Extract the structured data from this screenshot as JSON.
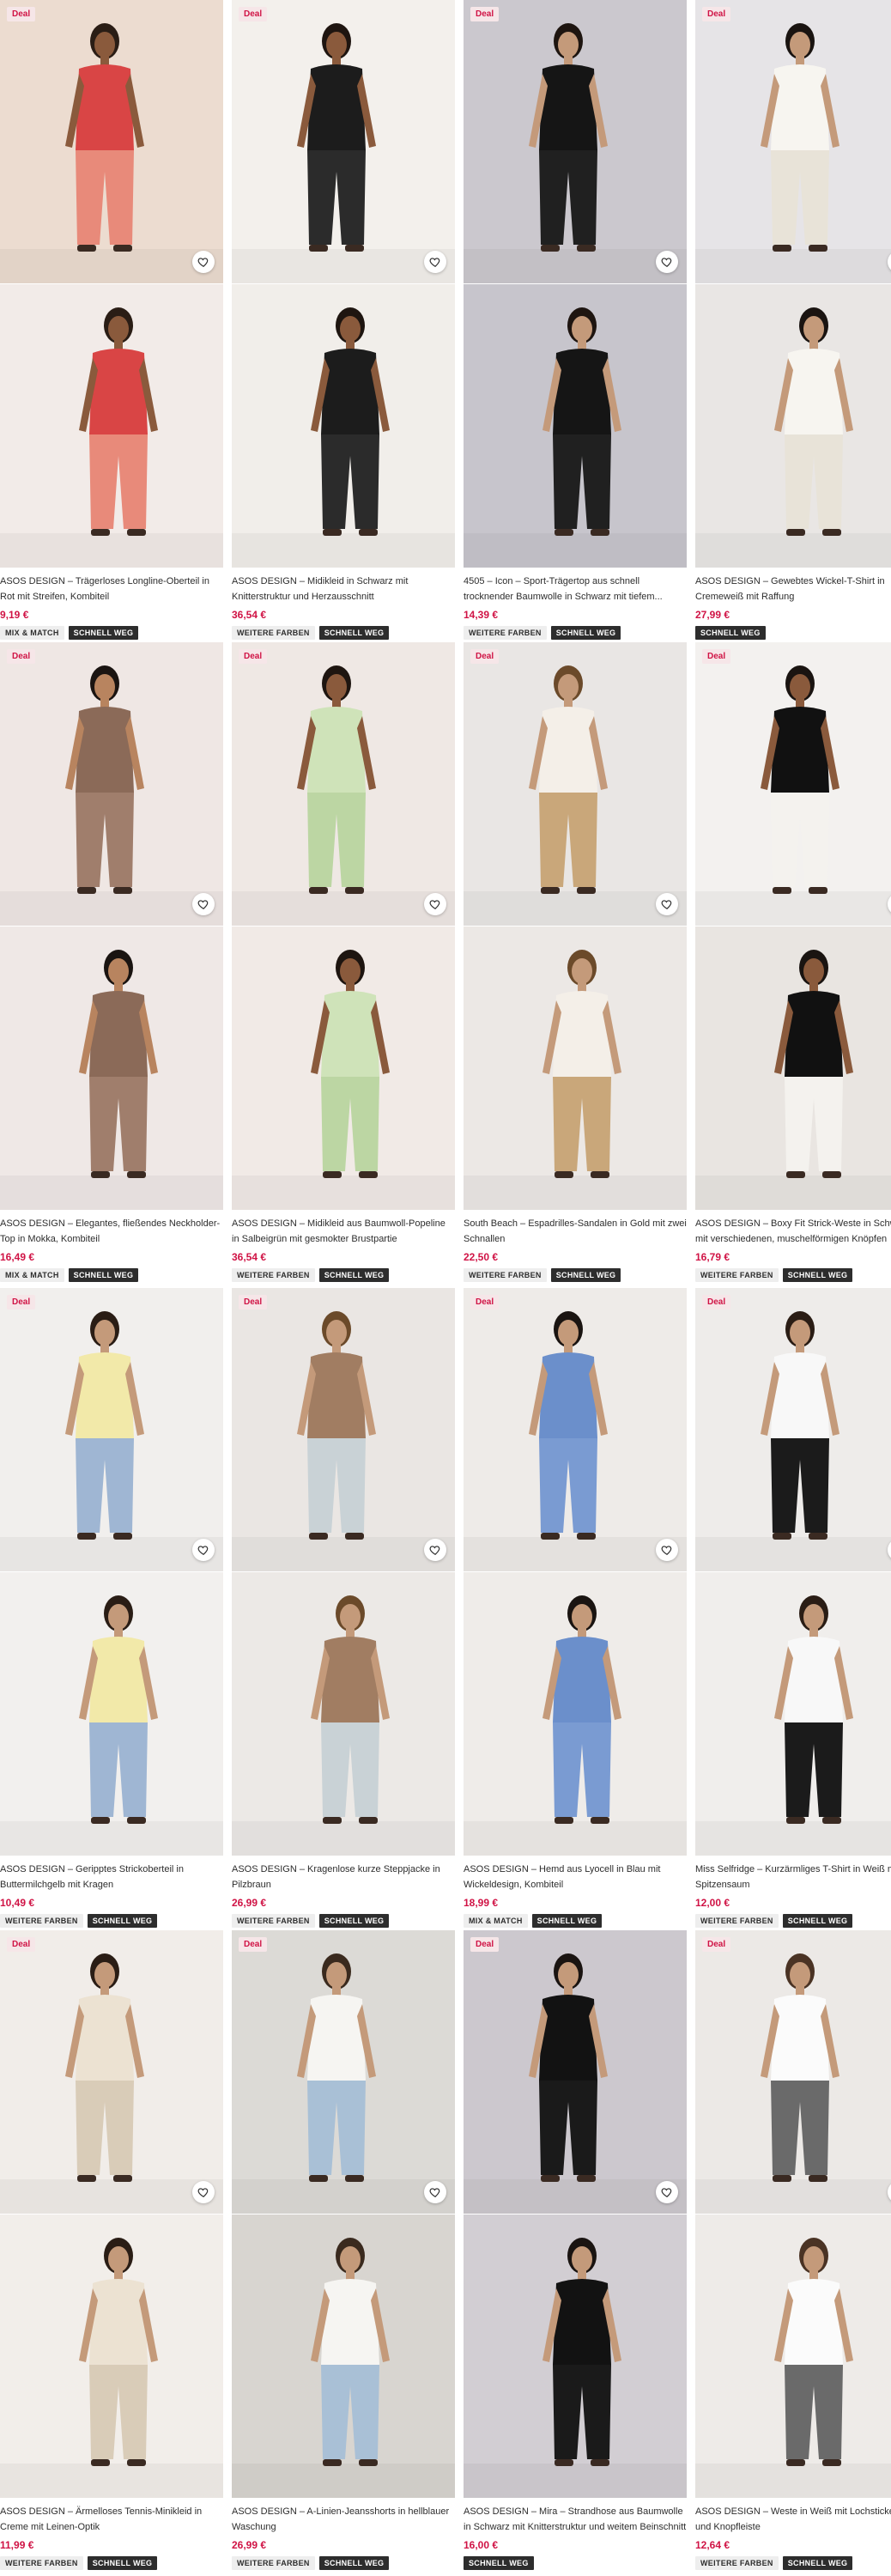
{
  "deal_label": "Deal",
  "products": [
    {
      "title": "ASOS DESIGN – Trägerloses Longline-Oberteil in Rot mit Streifen, Kombiteil",
      "price": "9,19 €",
      "badges": [
        "MIX & MATCH",
        "SCHNELL WEG"
      ],
      "bg_top": "#ecdcd0",
      "bg_bottom": "#f2ebe8",
      "garment": "#d94545",
      "garment2": "#e88a7a",
      "skin": "#8a5a3c",
      "hair": "#2a1d15"
    },
    {
      "title": "ASOS DESIGN – Midikleid in Schwarz mit Knitterstruktur und Herzausschnitt",
      "price": "36,54 €",
      "badges": [
        "WEITERE FARBEN",
        "SCHNELL WEG"
      ],
      "bg_top": "#f3f0ec",
      "bg_bottom": "#f1eeea",
      "garment": "#1c1c1c",
      "garment2": "#2b2b2b",
      "skin": "#8a5a3c",
      "hair": "#1e1510"
    },
    {
      "title": "4505 – Icon – Sport-Trägertop aus schnell trocknender Baumwolle in Schwarz mit tiefem...",
      "price": "14,39 €",
      "badges": [
        "WEITERE FARBEN",
        "SCHNELL WEG"
      ],
      "bg_top": "#cbc8ce",
      "bg_bottom": "#c7c5cc",
      "garment": "#151515",
      "garment2": "#202020",
      "skin": "#c49a7a",
      "hair": "#1e1510"
    },
    {
      "title": "ASOS DESIGN – Gewebtes Wickel-T-Shirt in Cremeweiß mit Raffung",
      "price": "27,99 €",
      "badges": [
        "SCHNELL WEG"
      ],
      "bg_top": "#e6e4e7",
      "bg_bottom": "#e9e6e4",
      "garment": "#f7f5f0",
      "garment2": "#e8e3d8",
      "skin": "#c49a7a",
      "hair": "#1a1411"
    },
    {
      "title": "ASOS DESIGN – Elegantes, fließendes Neckholder-Top in Mokka, Kombiteil",
      "price": "16,49 €",
      "badges": [
        "MIX & MATCH",
        "SCHNELL WEG"
      ],
      "bg_top": "#efe7e4",
      "bg_bottom": "#efe8e6",
      "garment": "#8b6a58",
      "garment2": "#a07e6c",
      "skin": "#b8845f",
      "hair": "#1a1411"
    },
    {
      "title": "ASOS DESIGN – Midikleid aus Baumwoll-Popeline in Salbeigrün mit gesmokter Brustpartie",
      "price": "36,54 €",
      "badges": [
        "WEITERE FARBEN",
        "SCHNELL WEG"
      ],
      "bg_top": "#efe8e4",
      "bg_bottom": "#f1eae6",
      "garment": "#cfe3b9",
      "garment2": "#bcd6a3",
      "skin": "#8a5a3c",
      "hair": "#1e1510"
    },
    {
      "title": "South Beach – Espadrilles-Sandalen in Gold mit zwei Schnallen",
      "price": "22,50 €",
      "badges": [
        "WEITERE FARBEN",
        "SCHNELL WEG"
      ],
      "bg_top": "#e9e6e4",
      "bg_bottom": "#ece8e5",
      "garment": "#f4efe8",
      "garment2": "#c9a77a",
      "skin": "#c49a7a",
      "hair": "#6b4a2a"
    },
    {
      "title": "ASOS DESIGN – Boxy Fit Strick-Weste in Schwarz mit verschiedenen, muschelförmigen Knöpfen",
      "price": "16,79 €",
      "badges": [
        "WEITERE FARBEN",
        "SCHNELL WEG"
      ],
      "bg_top": "#f3f1ef",
      "bg_bottom": "#e9e5e1",
      "garment": "#111111",
      "garment2": "#f4f2ee",
      "skin": "#8a5a3c",
      "hair": "#1a1411"
    },
    {
      "title": "ASOS DESIGN – Geripptes Strickoberteil in Buttermilchgelb mit Kragen",
      "price": "10,49 €",
      "badges": [
        "WEITERE FARBEN",
        "SCHNELL WEG"
      ],
      "bg_top": "#f1efed",
      "bg_bottom": "#f2f0ee",
      "garment": "#f2e9a9",
      "garment2": "#9fb6d3",
      "skin": "#c49a7a",
      "hair": "#2a1d15"
    },
    {
      "title": "ASOS DESIGN – Kragenlose kurze Steppjacke in Pilzbraun",
      "price": "26,99 €",
      "badges": [
        "WEITERE FARBEN",
        "SCHNELL WEG"
      ],
      "bg_top": "#eae6e3",
      "bg_bottom": "#ece9e6",
      "garment": "#a17d62",
      "garment2": "#c9d2d6",
      "skin": "#c49a7a",
      "hair": "#6b4a2a"
    },
    {
      "title": "ASOS DESIGN – Hemd aus Lyocell in Blau mit Wickeldesign, Kombiteil",
      "price": "18,99 €",
      "badges": [
        "MIX & MATCH",
        "SCHNELL WEG"
      ],
      "bg_top": "#eeebe8",
      "bg_bottom": "#efece9",
      "garment": "#6b8fcb",
      "garment2": "#7a9bd2",
      "skin": "#c49a7a",
      "hair": "#1a1411"
    },
    {
      "title": "Miss Selfridge – Kurzärmliges T-Shirt in Weiß mit Spitzensaum",
      "price": "12,00 €",
      "badges": [
        "WEITERE FARBEN",
        "SCHNELL WEG"
      ],
      "bg_top": "#eeecea",
      "bg_bottom": "#f0eeec",
      "garment": "#f8f8f8",
      "garment2": "#1b1b1b",
      "skin": "#c49a7a",
      "hair": "#2a1d15"
    },
    {
      "title": "ASOS DESIGN – Ärmelloses Tennis-Minikleid in Creme mit Leinen-Optik",
      "price": "11,99 €",
      "badges": [
        "WEITERE FARBEN",
        "SCHNELL WEG"
      ],
      "bg_top": "#f1ede9",
      "bg_bottom": "#f2eeea",
      "garment": "#ece2d2",
      "garment2": "#d9ccb8",
      "skin": "#c49a7a",
      "hair": "#2a1d15"
    },
    {
      "title": "ASOS DESIGN – A-Linien-Jeansshorts in hellblauer Waschung",
      "price": "26,99 €",
      "badges": [
        "WEITERE FARBEN",
        "SCHNELL WEG"
      ],
      "bg_top": "#dcdad6",
      "bg_bottom": "#d8d5d0",
      "garment": "#f6f5f2",
      "garment2": "#a9c0d6",
      "skin": "#c49a7a",
      "hair": "#3a2a1e"
    },
    {
      "title": "ASOS DESIGN – Mira – Strandhose aus Baumwolle in Schwarz mit Knitterstruktur und weitem Beinschnitt",
      "price": "16,00 €",
      "badges": [
        "SCHNELL WEG"
      ],
      "bg_top": "#ccc8ce",
      "bg_bottom": "#d2ced3",
      "garment": "#121212",
      "garment2": "#1a1a1a",
      "skin": "#c49a7a",
      "hair": "#1a1411"
    },
    {
      "title": "ASOS DESIGN – Weste in Weiß mit Lochstickerei und Knopfleiste",
      "price": "12,64 €",
      "badges": [
        "WEITERE FARBEN",
        "SCHNELL WEG"
      ],
      "bg_top": "#ece9e6",
      "bg_bottom": "#eeebe8",
      "garment": "#fbfbfb",
      "garment2": "#6a6a6a",
      "skin": "#c49a7a",
      "hair": "#4a3324"
    }
  ]
}
